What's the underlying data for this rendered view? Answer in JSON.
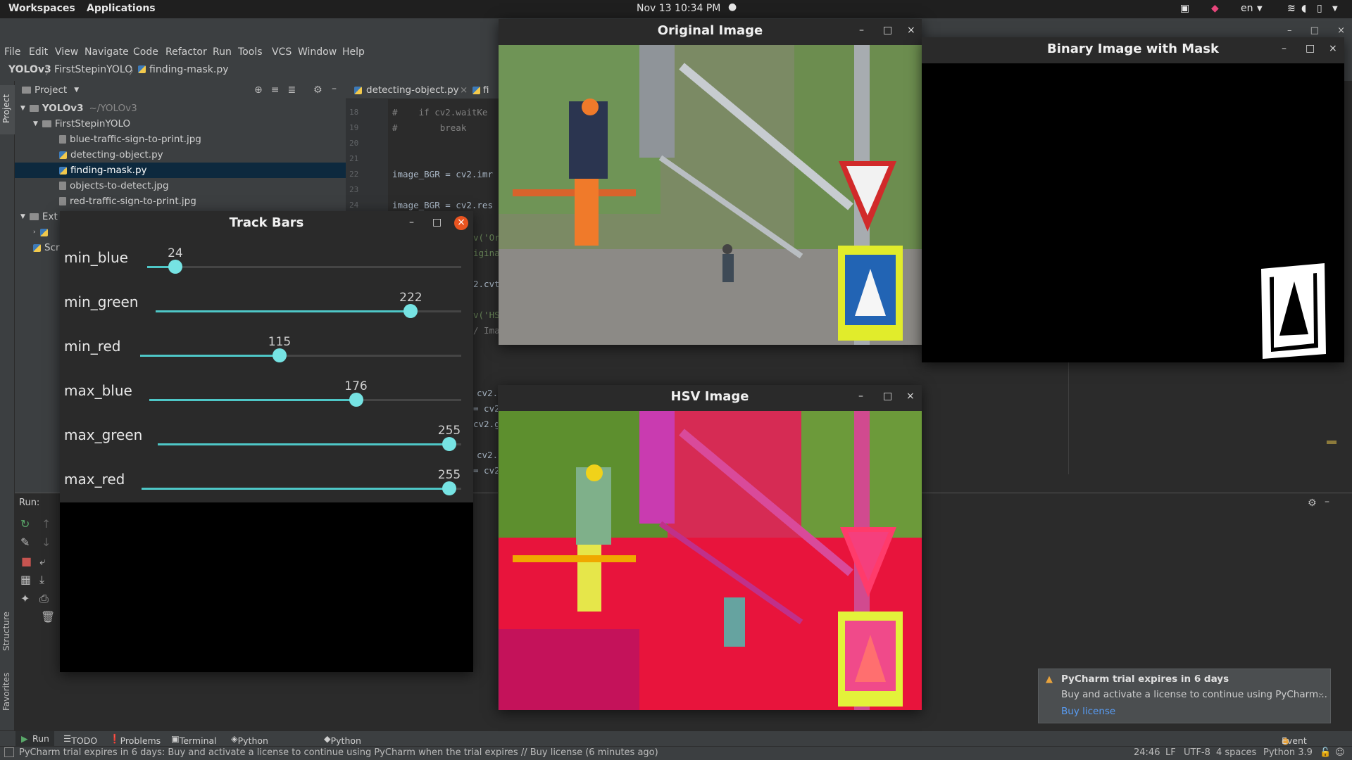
{
  "topbar": {
    "workspaces": "Workspaces",
    "applications": "Applications",
    "datetime": "Nov 13  10:34 PM",
    "lang": "en"
  },
  "menu": [
    "File",
    "Edit",
    "View",
    "Navigate",
    "Code",
    "Refactor",
    "Run",
    "Tools",
    "VCS",
    "Window",
    "Help"
  ],
  "breadcrumb": [
    "YOLOv3",
    "FirstStepinYOLO",
    "finding-mask.py"
  ],
  "project": {
    "header": "Project",
    "root": "YOLOv3",
    "root_path": "~/YOLOv3",
    "folder": "FirstStepinYOLO",
    "files": [
      "blue-traffic-sign-to-print.jpg",
      "detecting-object.py",
      "finding-mask.py",
      "objects-to-detect.jpg",
      "red-traffic-sign-to-print.jpg"
    ],
    "ext": "Ext",
    "scr": "Scr"
  },
  "tabs": {
    "tab1": "detecting-object.py",
    "tab2": "fi"
  },
  "code": {
    "lines": [
      {
        "n": "18",
        "t": "#    if cv2.waitKe"
      },
      {
        "n": "19",
        "t": "#        break"
      },
      {
        "n": "20",
        "t": ""
      },
      {
        "n": "21",
        "t": ""
      },
      {
        "n": "22",
        "t": "image_BGR = cv2.imr"
      },
      {
        "n": "23",
        "t": ""
      },
      {
        "n": "24",
        "t": "image_BGR = cv2.res"
      }
    ],
    "frag": [
      "v('Or",
      "igina",
      "2.cvt",
      "v('HS",
      "/ Ima",
      "cv2.",
      "= cv2",
      "cv2.g",
      "cv2.",
      "= cv2"
    ]
  },
  "trackbars": {
    "title": "Track Bars",
    "items": [
      {
        "label": "min_blue",
        "value": "24",
        "frac": 0.093
      },
      {
        "label": "min_green",
        "value": "222",
        "frac": 0.869
      },
      {
        "label": "min_red",
        "value": "115",
        "frac": 0.451
      },
      {
        "label": "max_blue",
        "value": "176",
        "frac": 0.689
      },
      {
        "label": "max_green",
        "value": "255",
        "frac": 1.0
      },
      {
        "label": "max_red",
        "value": "255",
        "frac": 1.0
      }
    ]
  },
  "windows": {
    "original": "Original Image",
    "hsv": "HSV Image",
    "binary": "Binary Image with Mask"
  },
  "run": {
    "label": "Run:"
  },
  "side": {
    "project": "Project",
    "structure": "Structure",
    "favorites": "Favorites"
  },
  "bottom_tools": [
    "Run",
    "TODO",
    "Problems",
    "Terminal",
    "Python Packages",
    "Python Console"
  ],
  "event_log": "Event Log",
  "notification": {
    "title": "PyCharm trial expires in 6 days",
    "body": "Buy and activate a license to continue using PyCharm...",
    "link": "Buy license"
  },
  "status": {
    "message": "PyCharm trial expires in 6 days: Buy and activate a license to continue using PyCharm when the trial expires // Buy license (6 minutes ago)",
    "pos": "24:46",
    "lf": "LF",
    "enc": "UTF-8",
    "indent": "4 spaces",
    "interp": "Python 3.9"
  },
  "colors": {
    "accent": "#4ec7c7",
    "thumb": "#76e3e3",
    "close_active": "#e95420"
  }
}
